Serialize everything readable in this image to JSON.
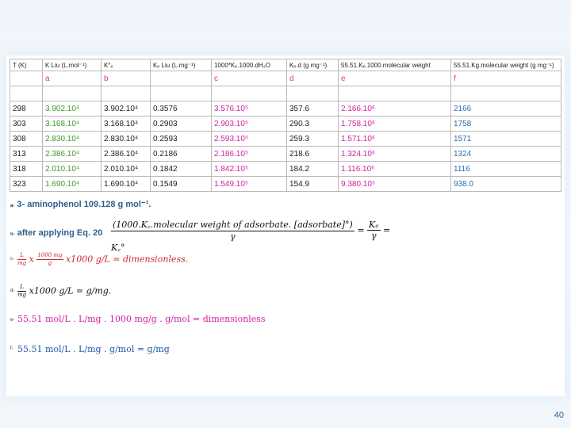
{
  "table": {
    "headers": [
      "T (K)",
      "K Liu (L.mol⁻¹)",
      "K°ₑ",
      "Kₑ Liu (L.mg⁻¹)",
      "1000*Kₑ.1000.dH₂O",
      "Kₑ.d  (g mg⁻¹)",
      "55.51.Kₑ.1000.molecular weight",
      "55.51.Kg.molecular weight (g mg⁻¹)"
    ],
    "letters": [
      "",
      "a",
      "b",
      "",
      "c",
      "d",
      "e",
      "f"
    ],
    "rows": [
      [
        "298",
        "3.902.10⁴",
        "3.902.10⁴",
        "0.3576",
        "3.576.10⁵",
        "357.6",
        "2.166.10⁶",
        "2166"
      ],
      [
        "303",
        "3.168.10⁴",
        "3.168.10⁴",
        "0.2903",
        "2.903.10⁵",
        "290.3",
        "1.758.10⁶",
        "1758"
      ],
      [
        "308",
        "2.830.10⁴",
        "2.830.10⁴",
        "0.2593",
        "2.593.10⁵",
        "259.3",
        "1.571.10⁶",
        "1571"
      ],
      [
        "313",
        "2.386.10⁴",
        "2.386.10⁴",
        "0.2186",
        "2.186.10⁵",
        "218.6",
        "1.324.10⁶",
        "1324"
      ],
      [
        "318",
        "2.010.10⁴",
        "2.010.10⁴",
        "0.1842",
        "1.842.10⁵",
        "184.2",
        "1.116.10⁶",
        "1116"
      ],
      [
        "323",
        "1.690.10⁴",
        "1.690.10⁴",
        "0.1549",
        "1.549.10⁵",
        "154.9",
        "9.380.10⁵",
        "938.0"
      ]
    ]
  },
  "notes": {
    "a_marker": "a-",
    "a_text": "3- aminophenol 109.128 g mol⁻¹.",
    "b_marker": "b-",
    "b_text": "after applying Eq. 20",
    "b_eq_num": "(1000.K꜀.molecular weight of adsorbate. [adsorbate]°)",
    "b_eq_den": "γ",
    "b_eq_rhs_num": "Kₑ",
    "b_eq_rhs_den": "γ",
    "b_eq_tail": "= K꜀°",
    "c_marker": "c-",
    "c_text": "x1000 g/L = dimensionless.",
    "d_marker": "d-",
    "d_text": "x1000 g/L = g/mg.",
    "e_marker": "e-",
    "e_text": "55.51 mol/L . L/mg . 1000 mg/g . g/mol = dimensionless",
    "f_marker": "f-",
    "f_text": "55.51 mol/L . L/mg . g/mol = g/mg"
  },
  "colors": {
    "green": "#3c9a2a",
    "magenta": "#d21f9a",
    "blue": "#2c6fb0",
    "title_blue": "#2c5f8e"
  },
  "page_number": "40"
}
